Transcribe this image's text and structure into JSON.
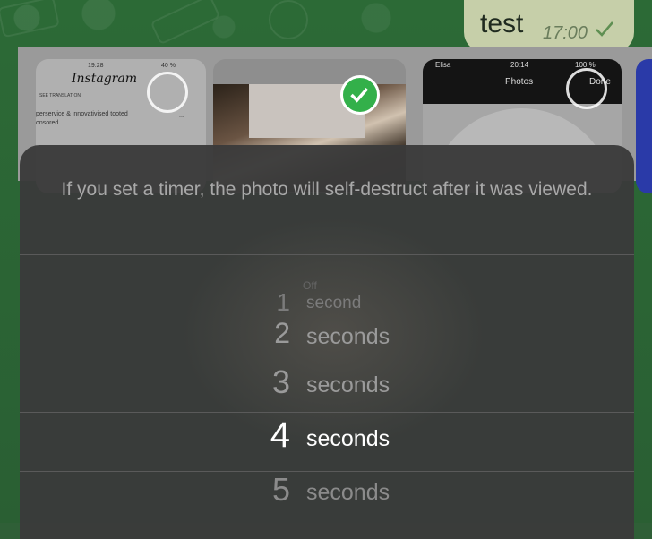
{
  "message": {
    "text": "test",
    "time": "17:00"
  },
  "thumbnails": {
    "first": {
      "status_time": "19:28",
      "status_battery": "40 %",
      "brand": "Instagram",
      "subtitle": "SEE TRANSLATION",
      "caption_line1": "perservice & innovativised tooted",
      "caption_line2": "onsored",
      "more": "..."
    },
    "third": {
      "carrier": "Elisa",
      "status_time": "20:14",
      "battery": "100 %",
      "title": "Photos",
      "done": "Done"
    }
  },
  "timer_sheet": {
    "hint": "If you set a timer, the photo will self-destruct after it was viewed.",
    "options": [
      {
        "num": "",
        "unit": "Off"
      },
      {
        "num": "1",
        "unit": "second"
      },
      {
        "num": "2",
        "unit": "seconds"
      },
      {
        "num": "3",
        "unit": "seconds"
      },
      {
        "num": "4",
        "unit": "seconds"
      },
      {
        "num": "5",
        "unit": "seconds"
      }
    ],
    "selected_index": 4
  },
  "colors": {
    "bubble": "#c6cfa9",
    "check_green": "#33b04a",
    "sheet": "#3a3a3a"
  }
}
